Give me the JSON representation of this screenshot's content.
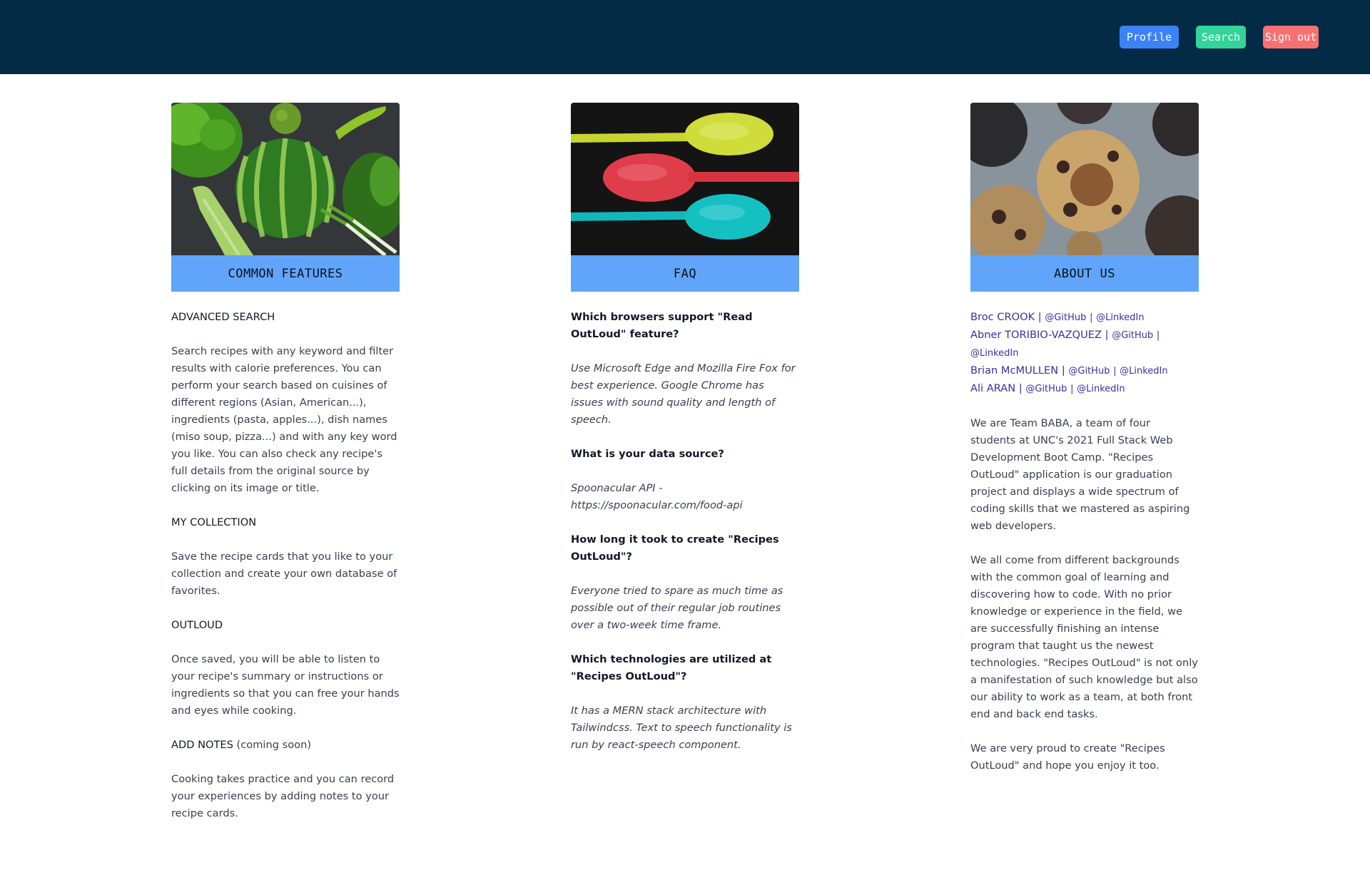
{
  "header": {
    "nav": {
      "profile": "Profile",
      "search": "Search",
      "signout": "Sign out"
    }
  },
  "colors": {
    "header_bg": "#032b46",
    "banner_bg": "#60a5fa",
    "profile_btn": "#3b82f6",
    "search_btn": "#34d399",
    "signout_btn": "#f87171"
  },
  "features": {
    "banner": "COMMON FEATURES",
    "image": "vegetables-watermelon-image",
    "sections": [
      {
        "title": "ADVANCED SEARCH",
        "title_suffix": "",
        "body": "Search recipes with any keyword and filter results with calorie preferences. You can perform your search based on cuisines of different regions (Asian, American...), ingredients (pasta, apples...), dish names (miso soup, pizza...) and with any key word you like. You can also check any recipe's full details from the original source by clicking on its image or title."
      },
      {
        "title": "MY COLLECTION",
        "title_suffix": "",
        "body": "Save the recipe cards that you like to your collection and create your own database of favorites."
      },
      {
        "title": "OUTLOUD",
        "title_suffix": "",
        "body": "Once saved, you will be able to listen to your recipe's summary or instructions or ingredients so that you can free your hands and eyes while cooking."
      },
      {
        "title": "ADD NOTES",
        "title_suffix": " (coming soon)",
        "body": "Cooking takes practice and you can record your experiences by adding notes to your recipe cards."
      }
    ]
  },
  "faq": {
    "banner": "FAQ",
    "image": "colorful-spoons-image",
    "items": [
      {
        "q": "Which browsers support \"Read OutLoud\" feature?",
        "a": "Use Microsoft Edge and Mozilla Fire Fox for best experience. Google Chrome has issues with sound quality and length of speech."
      },
      {
        "q": "What is your data source?",
        "a": "Spoonacular API - https://spoonacular.com/food-api"
      },
      {
        "q": "How long it took to create \"Recipes OutLoud\"?",
        "a": "Everyone tried to spare as much time as possible out of their regular job routines over a two-week time frame."
      },
      {
        "q": "Which technologies are utilized at \"Recipes OutLoud\"?",
        "a": "It has a MERN stack architecture with Tailwindcss. Text to speech functionality is run by react-speech component."
      }
    ]
  },
  "about": {
    "banner": "ABOUT US",
    "image": "cookies-image",
    "team": [
      {
        "name": "Broc CROOK",
        "github": "@GitHub",
        "linkedin": "@LinkedIn"
      },
      {
        "name": "Abner TORIBIO-VAZQUEZ",
        "github": "@GitHub",
        "linkedin": "@LinkedIn"
      },
      {
        "name": "Brian McMULLEN",
        "github": "@GitHub",
        "linkedin": "@LinkedIn"
      },
      {
        "name": "Ali ARAN",
        "github": "@GitHub",
        "linkedin": "@LinkedIn"
      }
    ],
    "separator": "|",
    "paragraphs": [
      "We are Team BABA, a team of four students at UNC's 2021 Full Stack Web Development Boot Camp. \"Recipes OutLoud\" application is our graduation project and displays a wide spectrum of coding skills that we mastered as aspiring web developers.",
      "We all come from different backgrounds with the common goal of learning and discovering how to code. With no prior knowledge or experience in the field, we are successfully finishing an intense program that taught us the newest technologies. \"Recipes OutLoud\" is not only a manifestation of such knowledge but also our ability to work as a team, at both front end and back end tasks.",
      "We are very proud to create \"Recipes OutLoud\" and hope you enjoy it too."
    ]
  }
}
